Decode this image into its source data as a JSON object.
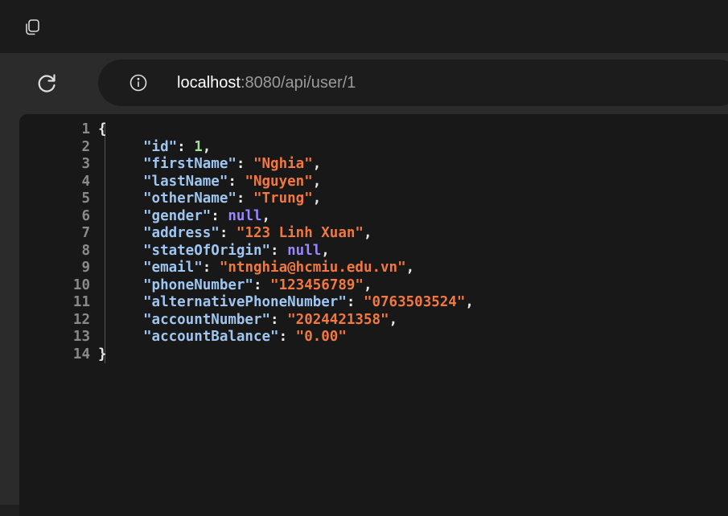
{
  "toolbar": {
    "url_host": "localhost",
    "url_rest": ":8080/api/user/1"
  },
  "json_view": {
    "open_brace": "{",
    "close_brace": "}",
    "lines": [
      {
        "num": "1"
      },
      {
        "num": "2",
        "key": "\"id\"",
        "value": "1",
        "value_type": "number",
        "comma": ","
      },
      {
        "num": "3",
        "key": "\"firstName\"",
        "value": "\"Nghia\"",
        "value_type": "string",
        "comma": ","
      },
      {
        "num": "4",
        "key": "\"lastName\"",
        "value": "\"Nguyen\"",
        "value_type": "string",
        "comma": ","
      },
      {
        "num": "5",
        "key": "\"otherName\"",
        "value": "\"Trung\"",
        "value_type": "string",
        "comma": ","
      },
      {
        "num": "6",
        "key": "\"gender\"",
        "value": "null",
        "value_type": "null",
        "comma": ","
      },
      {
        "num": "7",
        "key": "\"address\"",
        "value": "\"123 Linh Xuan\"",
        "value_type": "string",
        "comma": ","
      },
      {
        "num": "8",
        "key": "\"stateOfOrigin\"",
        "value": "null",
        "value_type": "null",
        "comma": ","
      },
      {
        "num": "9",
        "key": "\"email\"",
        "value": "\"ntnghia@hcmiu.edu.vn\"",
        "value_type": "string",
        "comma": ","
      },
      {
        "num": "10",
        "key": "\"phoneNumber\"",
        "value": "\"123456789\"",
        "value_type": "string",
        "comma": ","
      },
      {
        "num": "11",
        "key": "\"alternativePhoneNumber\"",
        "value": "\"0763503524\"",
        "value_type": "string",
        "comma": ","
      },
      {
        "num": "12",
        "key": "\"accountNumber\"",
        "value": "\"2024421358\"",
        "value_type": "string",
        "comma": ","
      },
      {
        "num": "13",
        "key": "\"accountBalance\"",
        "value": "\"0.00\"",
        "value_type": "string",
        "comma": ""
      },
      {
        "num": "14"
      }
    ]
  },
  "icons": {
    "tabs": "tab-actions-icon",
    "refresh": "refresh-icon",
    "info": "site-info-icon"
  },
  "colors": {
    "key": "#9fc6f0",
    "string": "#f2783f",
    "number": "#9ee39c",
    "null": "#9c86ff",
    "line_number": "#8a8a8a"
  }
}
